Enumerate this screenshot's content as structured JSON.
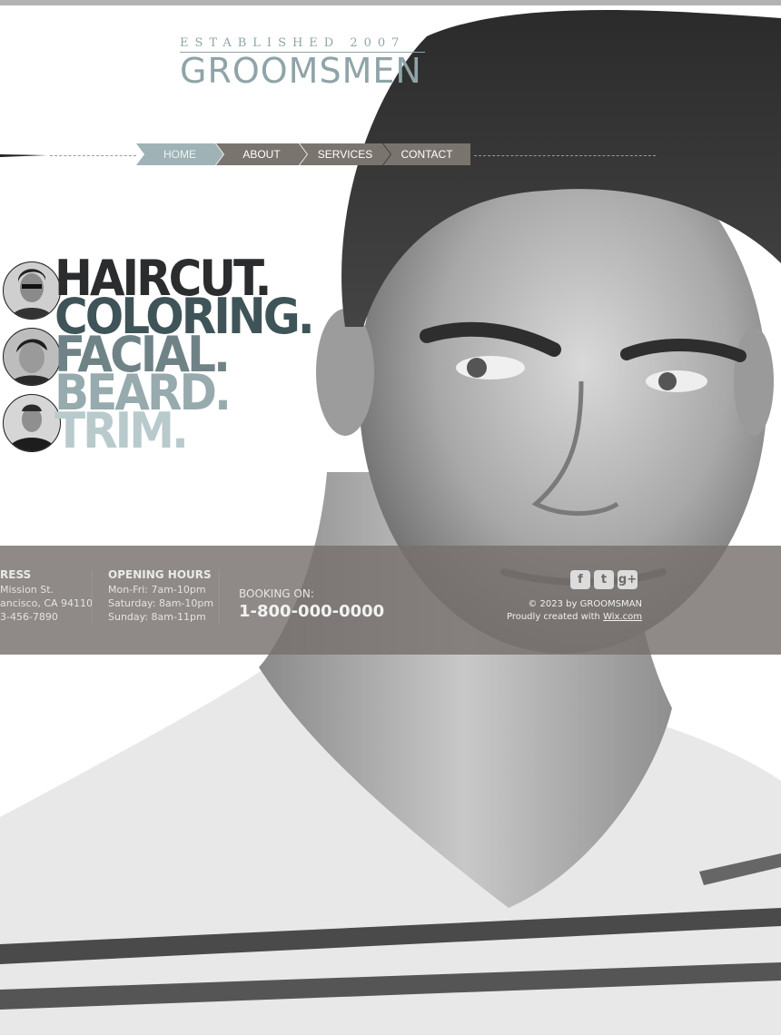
{
  "brand": {
    "tagline": "ESTABLISHED 2007",
    "name": "GROOMSMEN"
  },
  "nav": {
    "items": [
      {
        "label": "HOME",
        "active": true
      },
      {
        "label": "ABOUT",
        "active": false
      },
      {
        "label": "SERVICES",
        "active": false
      },
      {
        "label": "CONTACT",
        "active": false
      }
    ]
  },
  "services": [
    {
      "label": "HAIRCUT.",
      "color": "#2a2c2e"
    },
    {
      "label": "COLORING.",
      "color": "#3f5458"
    },
    {
      "label": "FACIAL.",
      "color": "#6f8387"
    },
    {
      "label": "BEARD.",
      "color": "#97aaad"
    },
    {
      "label": "TRIM.",
      "color": "#b9cacc"
    }
  ],
  "footer": {
    "address": {
      "heading": "RESS",
      "lines": [
        "Mission St.",
        "ancisco, CA 94110",
        "3-456-7890"
      ]
    },
    "hours": {
      "heading": "OPENING HOURS",
      "lines": [
        "Mon-Fri: 7am-10pm",
        "Saturday: 8am-10pm",
        "Sunday: 8am-11pm"
      ]
    },
    "booking": {
      "label": "BOOKING ON:",
      "phone": "1-800-000-0000"
    },
    "social": [
      {
        "icon": "facebook-icon",
        "glyph": "f"
      },
      {
        "icon": "twitter-icon",
        "glyph": "t"
      },
      {
        "icon": "google-plus-icon",
        "glyph": "g+"
      }
    ],
    "copyright": "© 2023 by GROOMSMAN",
    "credit_prefix": "Proudly created with",
    "credit_link": "Wix.com"
  },
  "colors": {
    "accent": "#8fa4a8",
    "nav_active": "#9fb3b7",
    "nav_inactive": "#7a746f",
    "footer_band": "#76706c"
  }
}
